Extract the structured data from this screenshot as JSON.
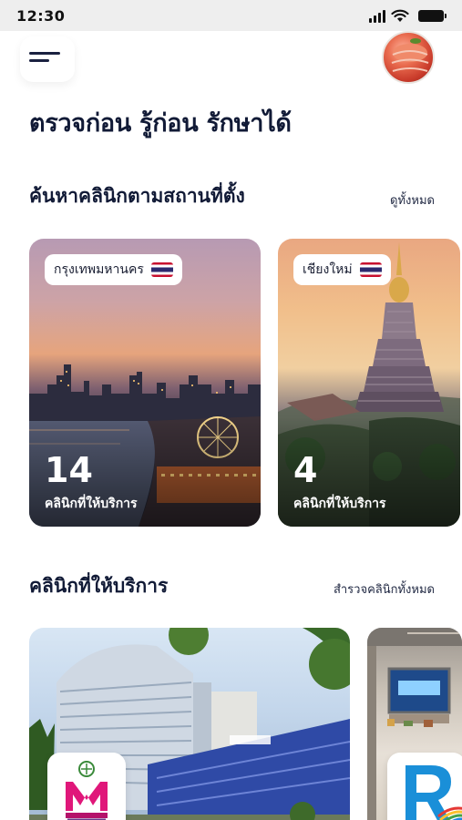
{
  "status_bar": {
    "time": "12:30",
    "icons": [
      "signal-icon",
      "wifi-icon",
      "battery-icon"
    ]
  },
  "header": {
    "menu_icon": "menu-icon",
    "avatar": "user-avatar"
  },
  "headline": "ตรวจก่อน รู้ก่อน รักษาได้",
  "location_section": {
    "title": "ค้นหาคลินิกตามสถานที่ตั้ง",
    "view_all": "ดูทั้งหมด",
    "cities": [
      {
        "name": "กรุงเทพมหานคร",
        "count": "14",
        "caption": "คลินิกที่ให้บริการ"
      },
      {
        "name": "เชียงใหม่",
        "count": "4",
        "caption": "คลินิกที่ให้บริการ"
      }
    ]
  },
  "clinic_section": {
    "title": "คลินิกที่ให้บริการ",
    "view_all": "สำรวจคลินิกทั้งหมด",
    "clinics": [
      {
        "logo": "msm-logo"
      },
      {
        "logo": "r-logo"
      }
    ]
  },
  "colors": {
    "text_dark": "#111a36",
    "flag_red": "#c8102e",
    "flag_blue": "#2d2a6e",
    "logo_magenta": "#e0177a"
  }
}
